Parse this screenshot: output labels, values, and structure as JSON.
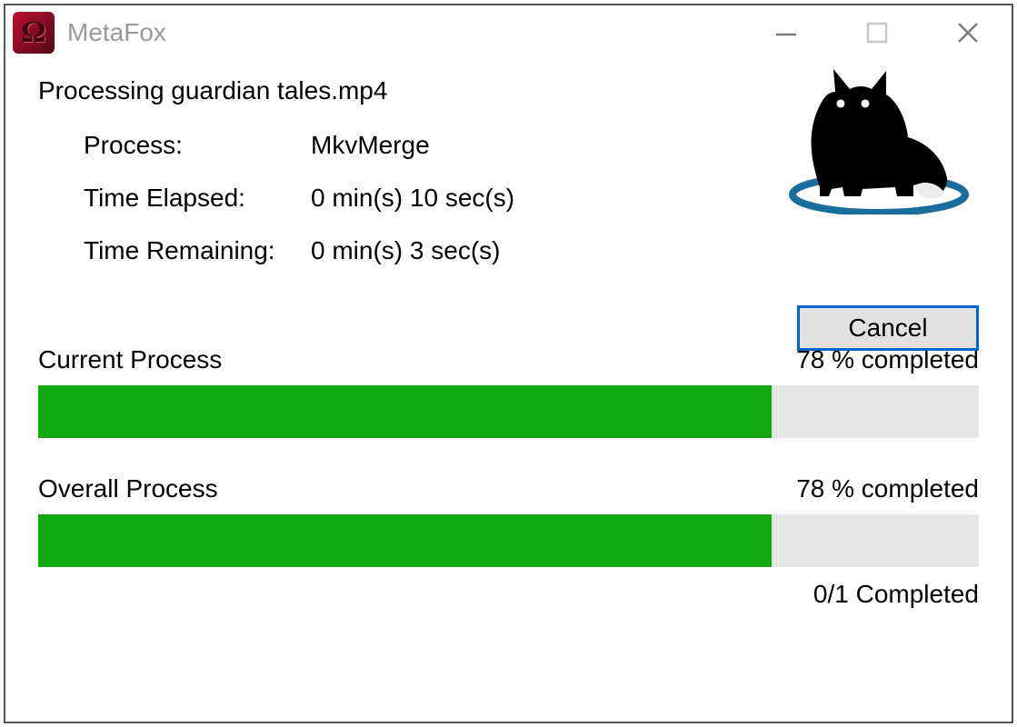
{
  "window": {
    "title": "MetaFox"
  },
  "status": {
    "processing_line": "Processing guardian tales.mp4",
    "process_label": "Process:",
    "process_value": "MkvMerge",
    "elapsed_label": "Time Elapsed:",
    "elapsed_value": "0 min(s) 10 sec(s)",
    "remaining_label": "Time Remaining:",
    "remaining_value": "0 min(s) 3 sec(s)"
  },
  "buttons": {
    "cancel": "Cancel"
  },
  "current": {
    "title": "Current Process",
    "percent_text": "78 % completed",
    "percent": 78
  },
  "overall": {
    "title": "Overall Process",
    "percent_text": "78 % completed",
    "percent": 78,
    "count_text": "0/1 Completed"
  }
}
